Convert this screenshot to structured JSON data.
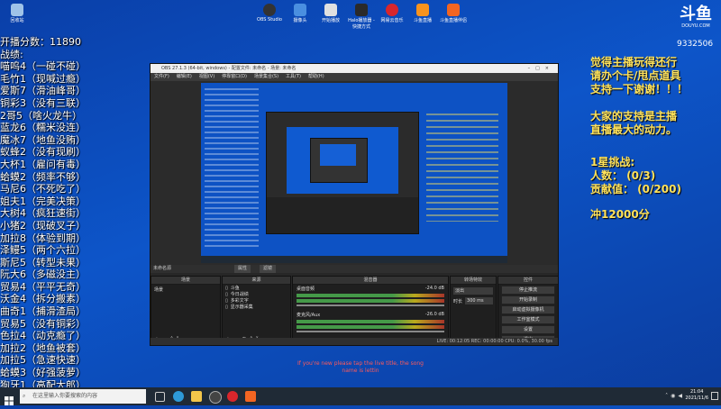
{
  "desktop": {
    "top_icons": [
      "OBS Studio",
      "摄像头",
      "开始播放",
      "Halo播放器 - 快捷方式",
      "网易云音乐",
      "斗鱼直播",
      "斗鱼直播伴侣"
    ],
    "left_icon": "回收站"
  },
  "overlay_left": {
    "score": "开播分数：11890",
    "section": "战绩:",
    "rows": [
      "喵呜4（一碰不碰）",
      "毛竹1（现喊过瘾）",
      "爱斯7（滑油峰哥）",
      "铜彩3（没有三联）",
      "2哥5（啥火龙牛）",
      "蓝龙6（糯米没连）",
      "魔冰7（地鱼没贿）",
      "蚁蜂2（没有现刷）",
      "大杯1（雇问有毒）",
      "蛤蟆2（频率不够）",
      "马尼6（不死吃了）",
      "姐夫1（完美决策）",
      "大树4（疯狂速街）",
      "小猪2（现破叉子）",
      "加拉8（体验到期）",
      "泽鳗5（两个六拉）",
      "斯尼5（转型未果）",
      "阮大6（多磁没主）",
      "贸易4（平平无奇）",
      "沃金4（拆分搬素）",
      "曲奇1（捕滑渣局）",
      "贸易5（没有铜彩）",
      "色拉4（动克瘾了）",
      "加拉2（地鱼被套）",
      "加拉5（急速快速）",
      "蛤蟆3（好强菠萝）",
      "狗牙1（高配大郎）"
    ]
  },
  "overlay_right": {
    "logo_text": "斗鱼",
    "logo_sub": "DOUYU.COM",
    "room_id": "9332506",
    "line1": "觉得主播玩得还行",
    "line2": "请办个卡/甩点道具",
    "line3": "支持一下谢谢！！！",
    "line4": "大家的支持是主播",
    "line5": "直播最大的动力。",
    "challenge_title": "1星挑战:",
    "people": "人数：  (0/3)",
    "contribution": "贡献值：  (0/200)",
    "goal": "冲12000分"
  },
  "obs": {
    "title": "OBS 27.1.3 (64-bit, windows) - 配置文件: 未命名 - 场景: 未命名",
    "menu": [
      "文件(F)",
      "编辑(E)",
      "视图(V)",
      "停靠窗口(D)",
      "场景集合(S)",
      "工具(T)",
      "帮助(H)"
    ],
    "scene_tab": "未命名源",
    "tab_props": "属性",
    "tab_filters": "滤镜",
    "panels": {
      "scenes": "场景",
      "sources": "来源",
      "mixer": "混音器",
      "transitions": "转场特效",
      "controls": "控件"
    },
    "scene_item": "场景",
    "sources": [
      "斗鱼",
      "今日战绩",
      "多彩文字",
      "显示器采集"
    ],
    "mixer": [
      {
        "name": "桌面音频",
        "db": "-24.0 dB"
      },
      {
        "name": "麦克风/Aux",
        "db": "-26.0 dB"
      }
    ],
    "transition": "淡出",
    "duration_label": "时长",
    "duration": "300 ms",
    "controls": [
      "停止推流",
      "开始录制",
      "启动虚拟摄像机",
      "工作室模式",
      "设置",
      "退出"
    ],
    "statusbar": "LIVE: 00:12:05   REC: 00:00:00   CPU: 0.0%, 30.00 fps"
  },
  "subtitle": {
    "line1": "If you're new please tap the live title, the song",
    "line2": "name is lettin"
  },
  "taskbar": {
    "search_placeholder": "在这里输入你要搜索的内容",
    "time": "21:04",
    "date": "2021/11/6"
  }
}
